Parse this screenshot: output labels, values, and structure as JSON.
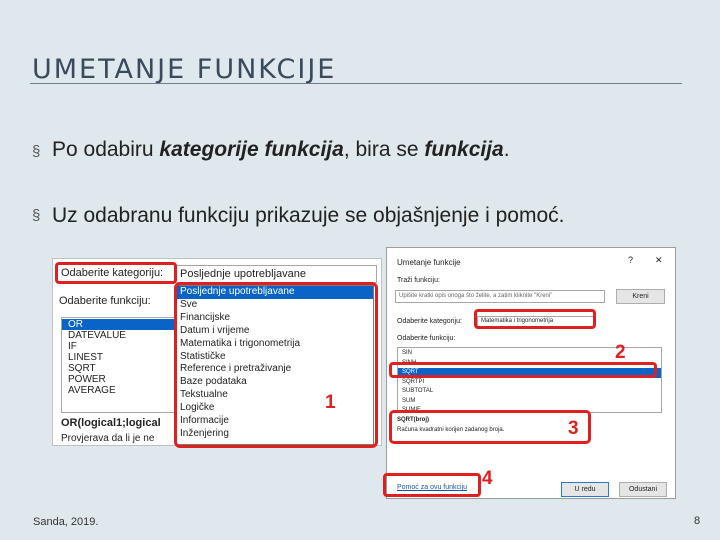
{
  "slide": {
    "title": "UMETANJE FUNKCIJE",
    "footer": "Sanda, 2019.",
    "page_number": "8"
  },
  "bullets": [
    {
      "marker": "§",
      "pre": "Po odabiru ",
      "bold": "kategorije funkcija",
      "mid": ", bira se ",
      "bold2": "funkcija",
      "post": "."
    },
    {
      "marker": "§",
      "text": "Uz odabranu funkciju prikazuje se objašnjenje i pomoć."
    }
  ],
  "left_dialog": {
    "category_label": "Odaberite kategoriju:",
    "category_value": "Posljednje upotrebljavane",
    "function_label": "Odaberite funkciju:",
    "functions": [
      "OR",
      "DATEVALUE",
      "IF",
      "LINEST",
      "SQRT",
      "POWER",
      "AVERAGE"
    ],
    "selected_function": "OR",
    "signature": "OR(logical1;logical",
    "description": "Provjerava da li je ne"
  },
  "category_dropdown": {
    "options": [
      "Posljednje upotrebljavane",
      "Sve",
      "Financijske",
      "Datum i vrijeme",
      "Matematika i trigonometrija",
      "Statističke",
      "Reference i pretraživanje",
      "Baze podataka",
      "Tekstualne",
      "Logičke",
      "Informacije",
      "Inženjering"
    ],
    "selected": "Posljednje upotrebljavane"
  },
  "right_dialog": {
    "title": "Umetanje funkcije",
    "help_glyph": "?",
    "close_glyph": "✕",
    "search_label": "Traži funkciju:",
    "search_placeholder": "Upišite kratki opis onoga što želite, a zatim kliknite \"Kreni\"",
    "find_button": "Kreni",
    "category_label": "Odaberite kategoriju:",
    "category_value": "Matematika i trigonometrija",
    "function_label": "Odaberite funkciju:",
    "functions": [
      "SIN",
      "SINH",
      "SQRT",
      "SQRTPI",
      "SUBTOTAL",
      "SUM",
      "SUMIF"
    ],
    "selected_function": "SQRT",
    "signature": "SQRT(broj)",
    "description": "Računa kvadratni korijen zadanog broja.",
    "help_link": "Pomoć za ovu funkciju",
    "ok_button": "U redu",
    "cancel_button": "Odustani"
  },
  "callouts": [
    "1",
    "2",
    "3",
    "4"
  ],
  "colors": {
    "highlight": "#e02020",
    "selection": "#0a64c8",
    "background": "#dfe8ec"
  }
}
